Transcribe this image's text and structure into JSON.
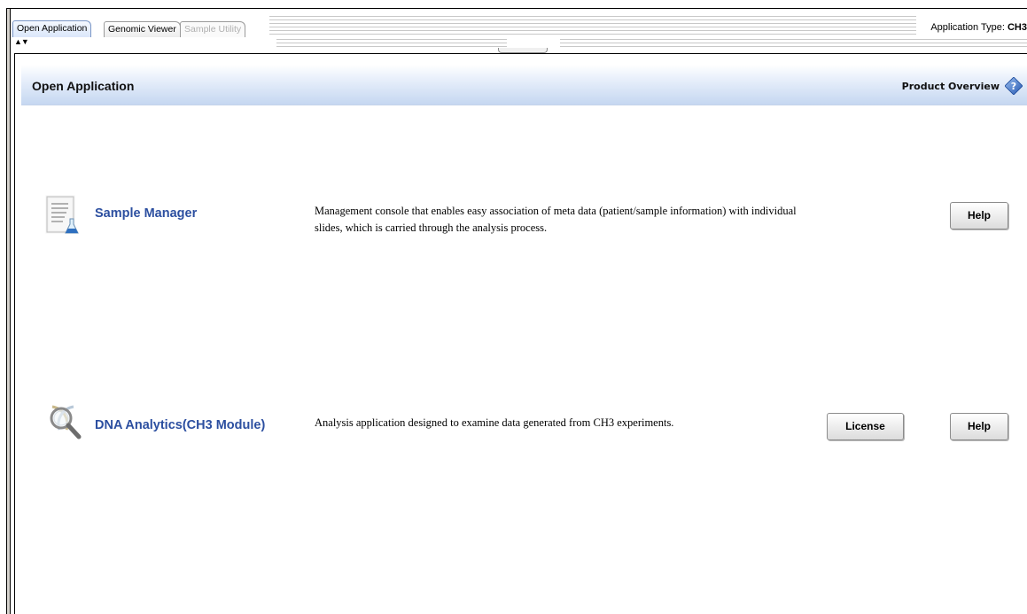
{
  "tabs": [
    {
      "label": "Open Application",
      "state": "active"
    },
    {
      "label": "Genomic Viewer",
      "state": "normal"
    },
    {
      "label": "Sample Utility",
      "state": "disabled"
    }
  ],
  "collapse_arrows": "▲▼",
  "app_type": {
    "label": "Application Type:",
    "value": "CH3"
  },
  "header": {
    "title": "Open Application",
    "product_overview": "Product Overview",
    "help_icon": "help-diamond-icon"
  },
  "applications": [
    {
      "name": "Sample Manager",
      "icon": "document-flask-icon",
      "description": "Management console that enables easy association of meta data (patient/sample information) with individual slides, which is carried through the analysis process.",
      "help_label": "Help"
    },
    {
      "name": "DNA Analytics(CH3 Module)",
      "icon": "magnifier-icon",
      "description": "Analysis application designed to examine data generated from CH3 experiments.",
      "license_label": "License",
      "help_label": "Help"
    }
  ],
  "colors": {
    "link": "#2c4fa0",
    "header_gradient_end": "#c5d7f1",
    "help_icon": "#3b6fc4"
  }
}
